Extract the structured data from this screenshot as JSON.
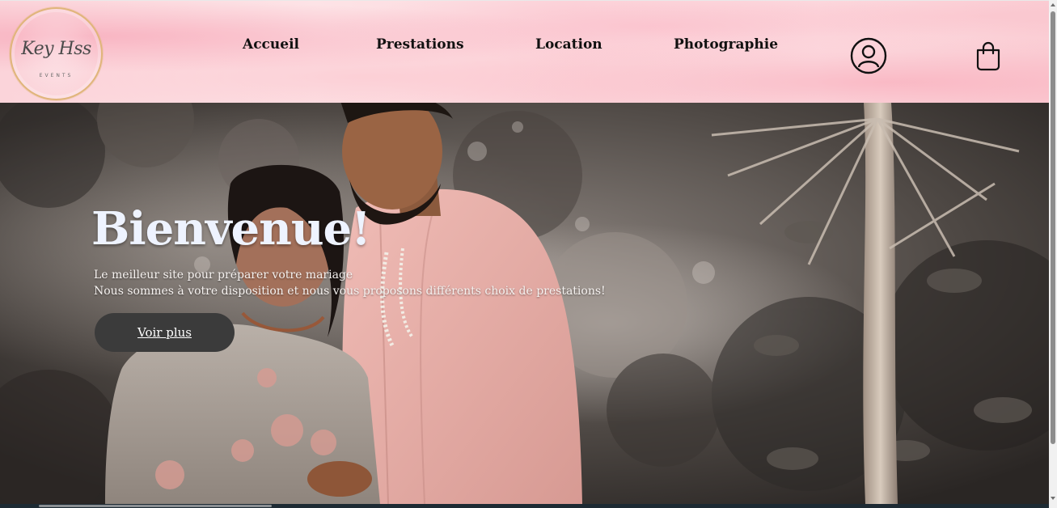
{
  "brand": {
    "logo_script": "Key Hss",
    "logo_sub": "EVENTS"
  },
  "nav": {
    "items": [
      {
        "label": "Accueil"
      },
      {
        "label": "Prestations"
      },
      {
        "label": "Location"
      },
      {
        "label": "Photographie"
      }
    ]
  },
  "header_icons": {
    "account": "user-icon",
    "cart": "shopping-bag-icon"
  },
  "hero": {
    "title": "Bienvenue!",
    "line1": "Le meilleur site pour préparer votre mariage",
    "line2": "Nous sommes à votre disposition et nous vous proposons différents choix de prestations!",
    "cta_label": "Voir plus"
  },
  "colors": {
    "header_pink": "#fcd8dd",
    "cta_bg": "#3b3b3b",
    "title_color": "#eef3ff",
    "logo_gold": "#e0b57a"
  }
}
